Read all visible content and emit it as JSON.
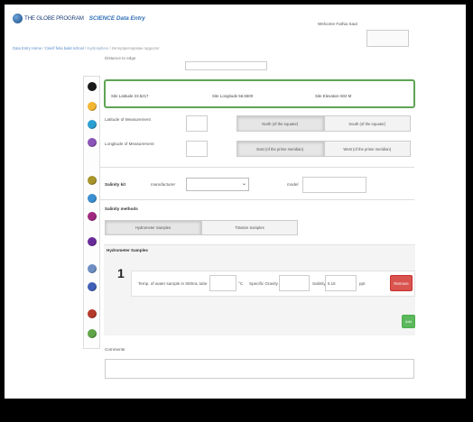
{
  "header": {
    "brand": "THE GLOBE PROGRAM",
    "section": "SCIENCE Data Entry",
    "welcome": "Welcome Fathia Saut"
  },
  "breadcrumb": {
    "items": [
      "Data Entry Home",
      "Ckerif fetia bakit school",
      "Hydrosphere",
      "Интерпретирован гидролог"
    ]
  },
  "form": {
    "truncated_label": "Distance to edge",
    "site": {
      "latitude": "Site Latitude 23.5217",
      "longitude": "Site Longitude 56.5500",
      "elevation": "Site Elevation 502 M"
    },
    "latitude_label": "Latitude of Measurement",
    "longitude_label": "Longitude of Measurement",
    "north": "North (of the equator)",
    "south": "South (of the equator)",
    "east": "East (of the prime meridian)",
    "west": "West (of the prime meridian)",
    "salinity_kit": "Salinity kit",
    "manufacturer": "manufacturer",
    "model": "model",
    "methods_title": "Salinity methods",
    "tabs": [
      "Hydrometer Samples",
      "Titration Samples"
    ],
    "samples_title": "Hydrometer Samples",
    "row_number": "1",
    "temp_label": "Temp. of water sample in 500mL tube",
    "temp_unit": "°C",
    "gravity_label": "Specific Gravity",
    "salinity_label": "Salinity",
    "salinity_value": "5.15",
    "salinity_unit": "ppt",
    "remove": "Remove",
    "add": "Add",
    "comments": "Comments"
  },
  "sidebar_icons": [
    {
      "name": "moon-icon",
      "color": "#1a1a1a"
    },
    {
      "name": "sun-icon",
      "color": "#f2b632"
    },
    {
      "name": "water-icon",
      "color": "#2b9fd1"
    },
    {
      "name": "purple-drop-icon",
      "color": "#8b54b8"
    },
    {
      "name": "gold-leaf-icon",
      "color": "#a8952b"
    },
    {
      "name": "blue-drop-icon",
      "color": "#3a8ed2"
    },
    {
      "name": "magenta-icon",
      "color": "#a0287e"
    },
    {
      "name": "violet-icon",
      "color": "#6a2b9a"
    },
    {
      "name": "teal-icon",
      "color": "#6d8fc4"
    },
    {
      "name": "indigo-icon",
      "color": "#3f5fb8"
    },
    {
      "name": "red-soil-icon",
      "color": "#b53a2c"
    },
    {
      "name": "green-land-icon",
      "color": "#5fa548"
    }
  ]
}
